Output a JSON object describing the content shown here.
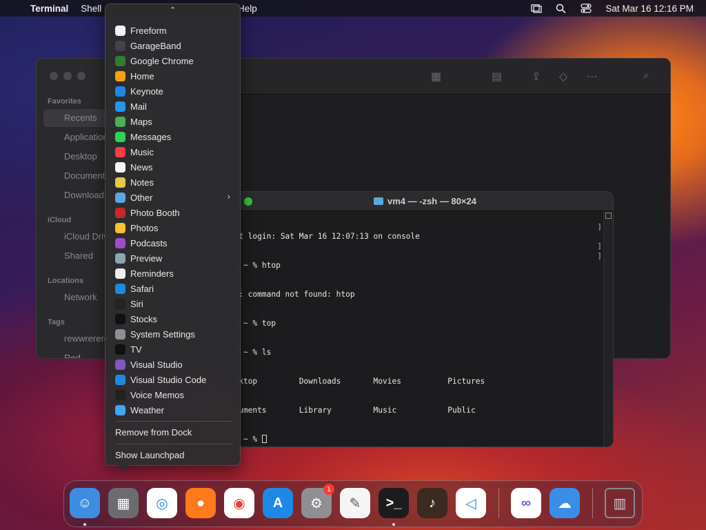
{
  "menubar": {
    "app_name": "Terminal",
    "menus": [
      "Shell",
      "Help"
    ],
    "clock": "Sat Mar 16  12:16 PM",
    "icons": [
      "apple-icon",
      "screen-mirroring-icon",
      "search-icon",
      "control-center-icon"
    ]
  },
  "finder": {
    "sections": {
      "favorites": "Favorites",
      "icloud": "iCloud",
      "locations": "Locations",
      "tags": "Tags"
    },
    "items": {
      "recents": "Recents",
      "applications": "Applications",
      "desktop": "Desktop",
      "documents": "Documents",
      "downloads": "Downloads",
      "icloud_drive": "iCloud Drive",
      "shared": "Shared",
      "network": "Network",
      "tag1": "rewwrerere",
      "tag2": "Red"
    }
  },
  "terminal": {
    "title": "vm4 — -zsh — 80×24",
    "lines": [
      "Last login: Sat Mar 16 12:07:13 on console",
      "vm4 ~ % htop",
      "zsh: command not found: htop",
      "vm4 ~ % top",
      "vm4 ~ % ls",
      "Desktop         Downloads       Movies          Pictures",
      "Documents       Library         Music           Public",
      "vm4 ~ % "
    ]
  },
  "context_menu": {
    "items": [
      {
        "label": "Freeform",
        "icon": "freeform-icon",
        "color": "#f2f2f2"
      },
      {
        "label": "GarageBand",
        "icon": "garageband-icon",
        "color": "#444"
      },
      {
        "label": "Google Chrome",
        "icon": "chrome-icon",
        "color": "#2e7d32"
      },
      {
        "label": "Home",
        "icon": "home-icon",
        "color": "#ff9f0a"
      },
      {
        "label": "Keynote",
        "icon": "keynote-icon",
        "color": "#1e88e5"
      },
      {
        "label": "Mail",
        "icon": "mail-icon",
        "color": "#2196f3"
      },
      {
        "label": "Maps",
        "icon": "maps-icon",
        "color": "#4caf50"
      },
      {
        "label": "Messages",
        "icon": "messages-icon",
        "color": "#30d158"
      },
      {
        "label": "Music",
        "icon": "music-icon",
        "color": "#fc3c44"
      },
      {
        "label": "News",
        "icon": "news-icon",
        "color": "#f5f5f5"
      },
      {
        "label": "Notes",
        "icon": "notes-icon",
        "color": "#e6c94a"
      },
      {
        "label": "Other",
        "icon": "folder-icon",
        "color": "#5aa8e0",
        "submenu": true
      },
      {
        "label": "Photo Booth",
        "icon": "photo-booth-icon",
        "color": "#c62828"
      },
      {
        "label": "Photos",
        "icon": "photos-icon",
        "color": "#fbc02d"
      },
      {
        "label": "Podcasts",
        "icon": "podcasts-icon",
        "color": "#9c4dcc"
      },
      {
        "label": "Preview",
        "icon": "preview-icon",
        "color": "#90a4ae"
      },
      {
        "label": "Reminders",
        "icon": "reminders-icon",
        "color": "#eeeeee"
      },
      {
        "label": "Safari",
        "icon": "safari-icon",
        "color": "#1e88e5"
      },
      {
        "label": "Siri",
        "icon": "siri-icon",
        "color": "#222"
      },
      {
        "label": "Stocks",
        "icon": "stocks-icon",
        "color": "#111"
      },
      {
        "label": "System Settings",
        "icon": "system-settings-icon",
        "color": "#8e8e93"
      },
      {
        "label": "TV",
        "icon": "tv-icon",
        "color": "#111"
      },
      {
        "label": "Visual Studio",
        "icon": "visual-studio-icon",
        "color": "#7e57c2"
      },
      {
        "label": "Visual Studio Code",
        "icon": "vscode-icon",
        "color": "#1e88e5"
      },
      {
        "label": "Voice Memos",
        "icon": "voice-memos-icon",
        "color": "#222"
      },
      {
        "label": "Weather",
        "icon": "weather-icon",
        "color": "#42a5f5"
      }
    ],
    "remove_label": "Remove from Dock",
    "launchpad_label": "Show Launchpad"
  },
  "dock": {
    "apps": [
      {
        "name": "finder-icon",
        "color": "#3d8de0",
        "running": true
      },
      {
        "name": "launchpad-icon",
        "color": "#6b6b70",
        "running": false
      },
      {
        "name": "safari-icon",
        "color": "#ffffff",
        "running": false
      },
      {
        "name": "firefox-icon",
        "color": "#ff7a1a",
        "running": false
      },
      {
        "name": "chrome-icon",
        "color": "#ffffff",
        "running": false
      },
      {
        "name": "app-store-icon",
        "color": "#1e88e5",
        "running": false
      },
      {
        "name": "system-settings-icon",
        "color": "#8e8e93",
        "running": false
      },
      {
        "name": "textedit-icon",
        "color": "#f5f5f5",
        "running": false
      },
      {
        "name": "terminal-icon",
        "color": "#1c1c1e",
        "running": true
      },
      {
        "name": "garageband-icon",
        "color": "#3b2a20",
        "running": false
      },
      {
        "name": "vscode-icon",
        "color": "#ffffff",
        "running": false
      },
      {
        "name": "visual-studio-icon",
        "color": "#ffffff",
        "running": false
      },
      {
        "name": "weather-icon",
        "color": "#3a8ee6",
        "running": false
      },
      {
        "name": "trash-icon",
        "color": "#7a7a80",
        "running": false
      }
    ],
    "settings_badge": "1"
  }
}
